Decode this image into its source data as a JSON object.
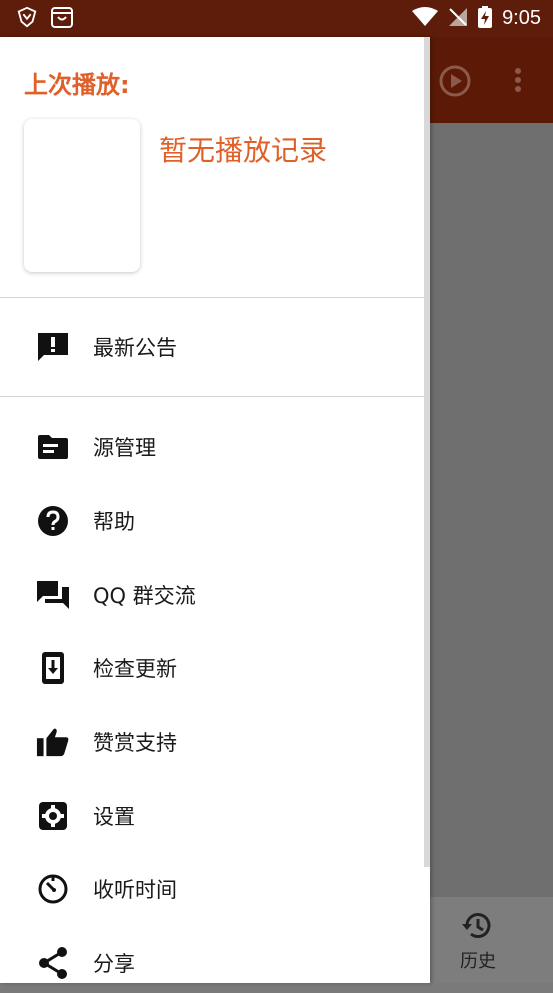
{
  "status_bar": {
    "time": "9:05"
  },
  "background_app": {
    "bottom_nav": {
      "history_label": "历史"
    }
  },
  "drawer": {
    "last_played_title": "上次播放:",
    "no_record_text": "暂无播放记录",
    "menu": [
      {
        "label": "最新公告",
        "icon": "announcement-icon"
      },
      {
        "label": "源管理",
        "icon": "folder-icon"
      },
      {
        "label": "帮助",
        "icon": "help-icon"
      },
      {
        "label": "QQ 群交流",
        "icon": "chat-icon"
      },
      {
        "label": "检查更新",
        "icon": "update-icon"
      },
      {
        "label": "赞赏支持",
        "icon": "thumb-up-icon"
      },
      {
        "label": "设置",
        "icon": "settings-icon"
      },
      {
        "label": "收听时间",
        "icon": "timer-icon"
      },
      {
        "label": "分享",
        "icon": "share-icon"
      }
    ]
  },
  "colors": {
    "accent": "#e0602a",
    "status_bar": "#5e1d0a",
    "toolbar": "#5c1a06"
  }
}
